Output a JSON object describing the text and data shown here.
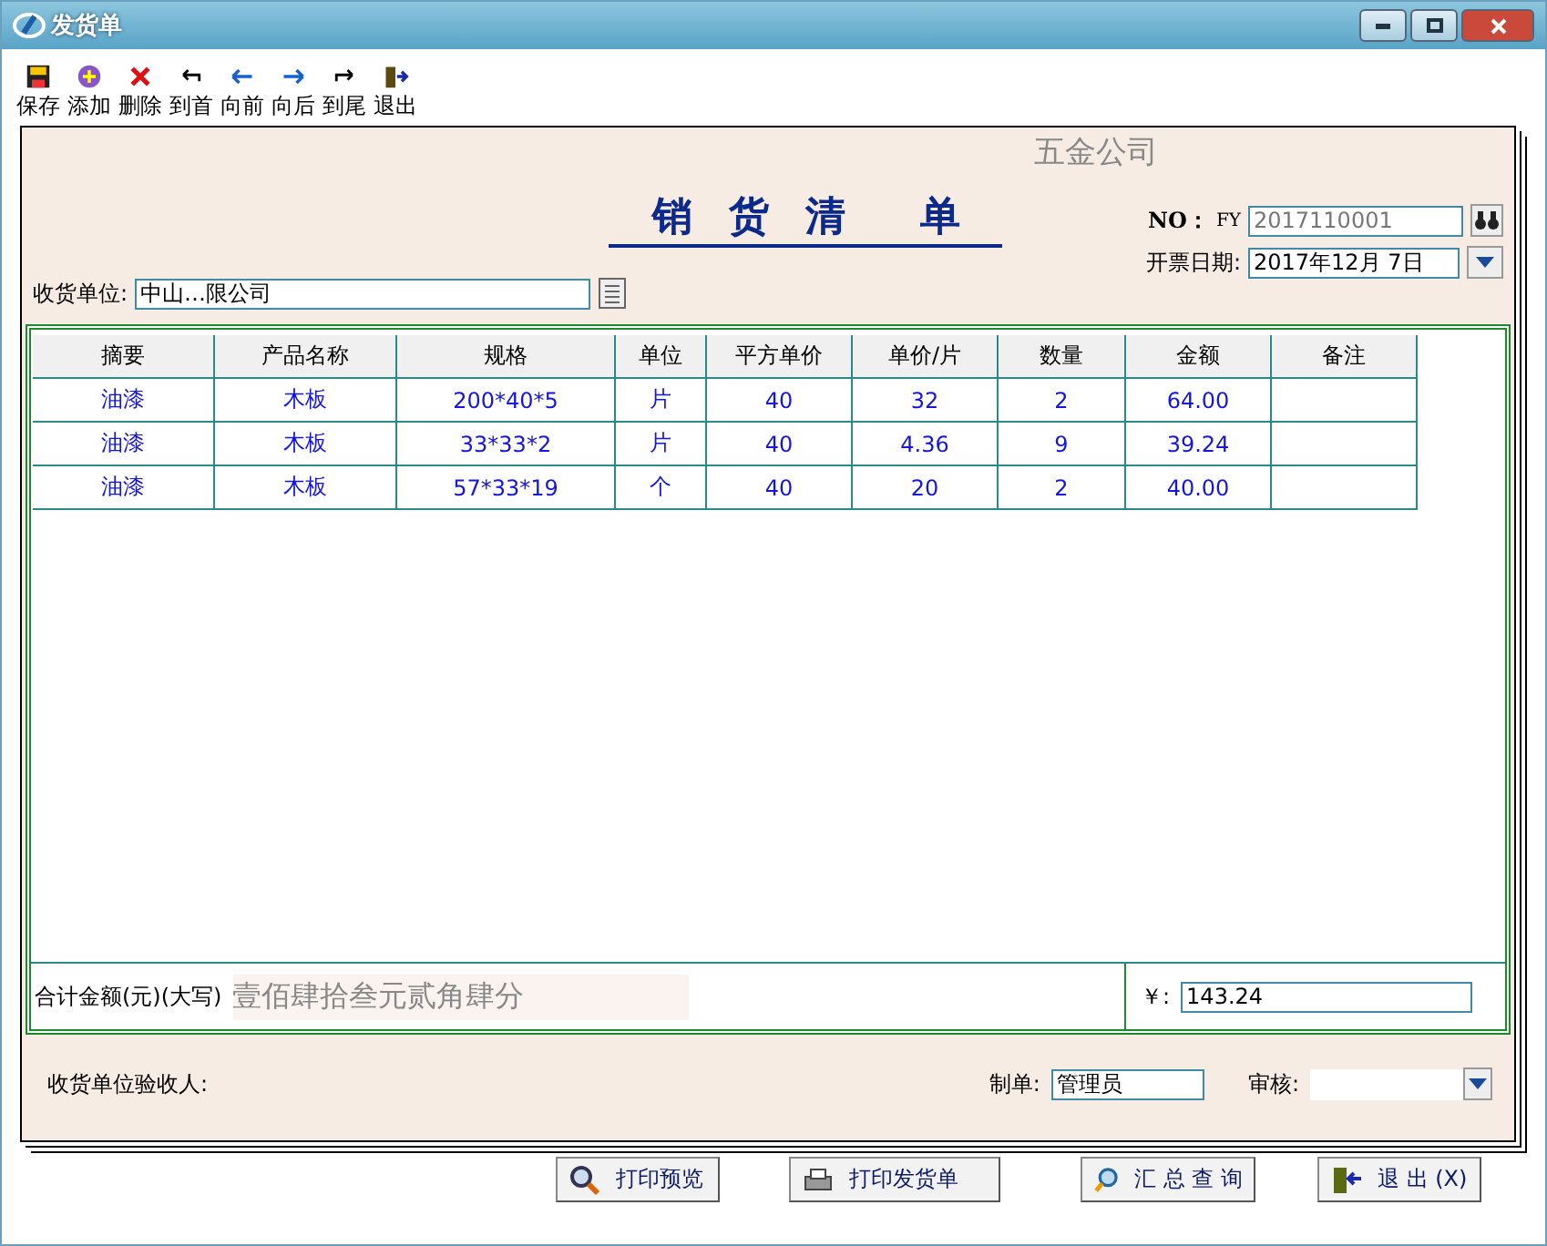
{
  "window": {
    "title": "发货单"
  },
  "toolbar": [
    {
      "kind": "save",
      "label": "保存"
    },
    {
      "kind": "add",
      "label": "添加"
    },
    {
      "kind": "delete",
      "label": "删除"
    },
    {
      "kind": "first",
      "label": "到首"
    },
    {
      "kind": "prev",
      "label": "向前"
    },
    {
      "kind": "next",
      "label": "向后"
    },
    {
      "kind": "last",
      "label": "到尾"
    },
    {
      "kind": "exit",
      "label": "退出"
    }
  ],
  "form": {
    "company": "五金公司",
    "title": "销　货　清　　单",
    "no_label": "NO：",
    "no_prefix": "FY",
    "no_value": "2017110001",
    "receiver_label": "收货单位:",
    "receiver_value": "中山…限公司",
    "date_label": "开票日期:",
    "date_value": "2017年12月 7日"
  },
  "table": {
    "columns": [
      "摘要",
      "产品名称",
      "规格",
      "单位",
      "平方单价",
      "单价/片",
      "数量",
      "金额",
      "备注"
    ],
    "rows": [
      [
        "油漆",
        "木板",
        "200*40*5",
        "片",
        "40",
        "32",
        "2",
        "64.00",
        ""
      ],
      [
        "油漆",
        "木板",
        "33*33*2",
        "片",
        "40",
        "4.36",
        "9",
        "39.24",
        ""
      ],
      [
        "油漆",
        "木板",
        "57*33*19",
        "个",
        "40",
        "20",
        "2",
        "40.00",
        ""
      ]
    ]
  },
  "total": {
    "label": "合计金额(元)(大写)",
    "words": "壹佰肆拾叁元贰角肆分",
    "currency_label": "￥:",
    "amount": "143.24"
  },
  "footer": {
    "acceptor_label": "收货单位验收人:",
    "maker_label": "制单:",
    "maker_value": "管理员",
    "audit_label": "审核:"
  },
  "buttons": [
    {
      "kind": "preview",
      "label": "打印预览"
    },
    {
      "kind": "print",
      "label": "打印发货单"
    },
    {
      "kind": "query",
      "label": "汇 总 查 询"
    },
    {
      "kind": "exit",
      "label": "退 出 (X)"
    }
  ]
}
